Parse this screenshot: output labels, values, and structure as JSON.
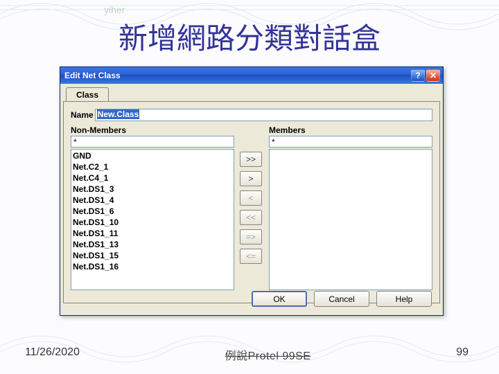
{
  "watermark": "yiher",
  "title": "新增網路分類對話盒",
  "dialog": {
    "title": "Edit Net Class",
    "tab_label": "Class",
    "name_label": "Name",
    "name_value": "New.Class",
    "nonmembers_label": "Non-Members",
    "members_label": "Members",
    "filter_nonmembers": "*",
    "filter_members": "*",
    "nonmembers": [
      "GND",
      "Net.C2_1",
      "Net.C4_1",
      "Net.DS1_3",
      "Net.DS1_4",
      "Net.DS1_6",
      "Net.DS1_10",
      "Net.DS1_11",
      "Net.DS1_13",
      "Net.DS1_15",
      "Net.DS1_16"
    ],
    "members": [],
    "buttons": {
      "add_all": ">>",
      "add_one": ">",
      "remove_one": "<",
      "remove_all": "<<",
      "exchange1": "=>",
      "exchange2": "<="
    },
    "actions": {
      "ok": "OK",
      "cancel": "Cancel",
      "help": "Help"
    }
  },
  "footer": {
    "date": "11/26/2020",
    "mid": "例說Protel 99SE",
    "page": "99"
  }
}
